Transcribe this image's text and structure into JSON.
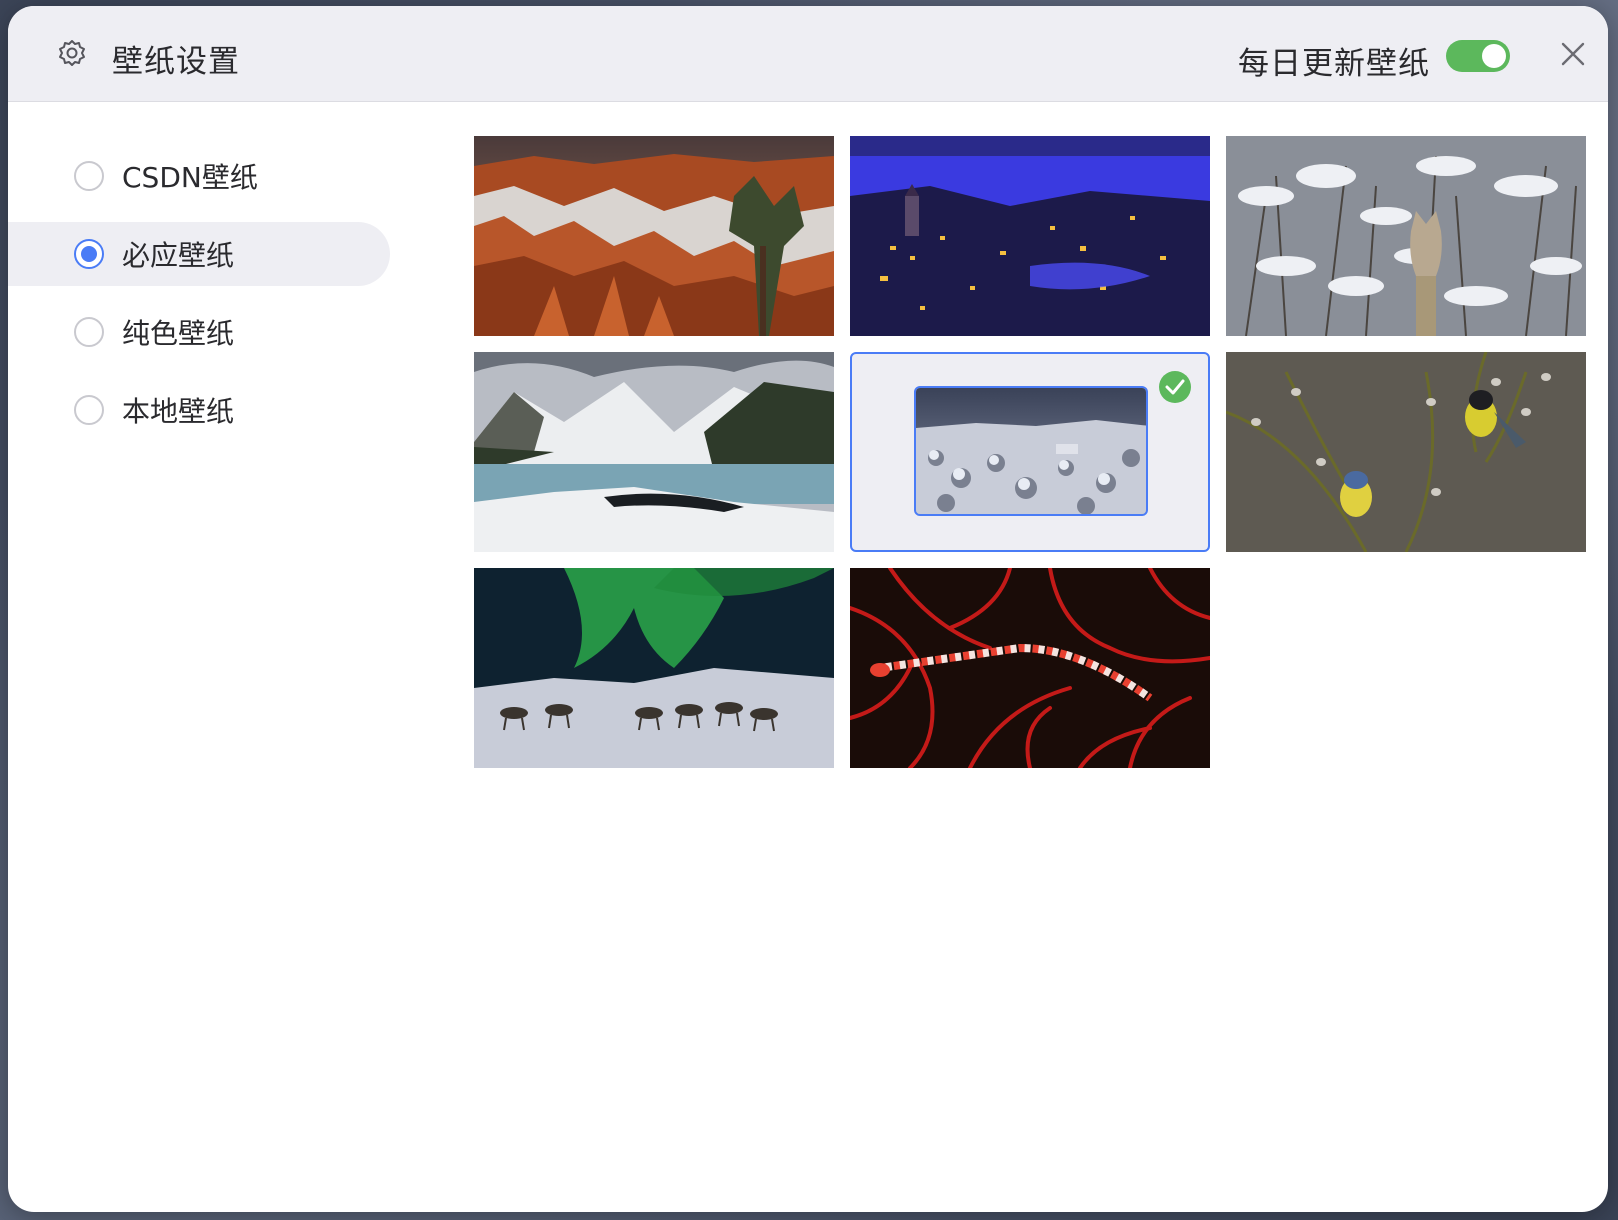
{
  "header": {
    "title": "壁纸设置",
    "daily_update_label": "每日更新壁纸",
    "daily_update_enabled": true
  },
  "sidebar": {
    "options": [
      {
        "label": "CSDN壁纸",
        "selected": false
      },
      {
        "label": "必应壁纸",
        "selected": true
      },
      {
        "label": "纯色壁纸",
        "selected": false
      },
      {
        "label": "本地壁纸",
        "selected": false
      }
    ]
  },
  "colors": {
    "accent": "#4a7cf6",
    "toggle_on": "#5cb85c",
    "check": "#5cb85c",
    "header_bg": "#eeeef3"
  },
  "wallpapers": {
    "count": 8,
    "selected_index": 4
  }
}
